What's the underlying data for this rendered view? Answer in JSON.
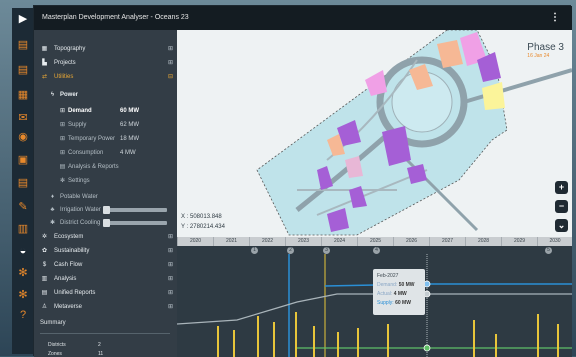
{
  "window": {
    "title": "Masterplan Development Analyser - Oceans 23",
    "menu_icon": "kebab-menu-icon"
  },
  "rail": {
    "icons": [
      "document-icon",
      "document-icon",
      "map-icon",
      "mail-icon",
      "layers-icon",
      "gauge-icon",
      "camera-icon",
      "gear-icon",
      "document-icon",
      "wrench-icon",
      "chart-icon",
      "dashboard-icon",
      "gear-icon",
      "gear-icon",
      "help-icon"
    ]
  },
  "sidebar": {
    "items": [
      {
        "label": "Topography",
        "icon": "map-icon"
      },
      {
        "label": "Projects",
        "icon": "buildings-icon"
      },
      {
        "label": "Utilities",
        "icon": "utilities-icon"
      }
    ],
    "power": {
      "label": "Power",
      "rows": [
        {
          "label": "Demand",
          "value": "60 MW"
        },
        {
          "label": "Supply",
          "value": "62 MW"
        },
        {
          "label": "Temporary Power",
          "value": "18 MW"
        },
        {
          "label": "Consumption",
          "value": "4 MW"
        },
        {
          "label": "Analysis & Reports",
          "value": ""
        },
        {
          "label": "Settings",
          "value": ""
        }
      ]
    },
    "water": [
      {
        "label": "Potable Water"
      },
      {
        "label": "Irrigation Water"
      },
      {
        "label": "District Cooling"
      }
    ],
    "items2": [
      {
        "label": "Ecosystem",
        "icon": "ecosystem-icon"
      },
      {
        "label": "Sustainability",
        "icon": "sustainability-icon"
      },
      {
        "label": "Cash Flow",
        "icon": "dollar-icon"
      },
      {
        "label": "Analysis",
        "icon": "chart-icon"
      },
      {
        "label": "Unified Reports",
        "icon": "report-icon"
      },
      {
        "label": "Metaverse",
        "icon": "person-icon"
      }
    ],
    "summary": {
      "title": "Summary",
      "rows": [
        {
          "label": "Districts",
          "value": "2"
        },
        {
          "label": "Zones",
          "value": "11"
        }
      ]
    }
  },
  "map": {
    "phase_title": "Phase 3",
    "phase_date": "16 Jan 24",
    "x_coord": "X : 508013.848",
    "y_coord": "Y : 2780214.434",
    "zoom_in": "+",
    "zoom_out": "−",
    "collapse": "⌄"
  },
  "timeline": {
    "years": [
      "2020",
      "2021",
      "2022",
      "2023",
      "2024",
      "2025",
      "2026",
      "2027",
      "2028",
      "2029",
      "2030"
    ],
    "markers": [
      "1",
      "2",
      "3",
      "4",
      "5"
    ],
    "tooltip": {
      "date": "Feb-2027",
      "demand_label": "Demand:",
      "demand_value": "50 MW",
      "actual_label": "Actual:",
      "actual_value": "4 MW",
      "supply_label": "Supply:",
      "supply_value": "60 MW"
    },
    "colors": {
      "supply": "#2a8fd6",
      "demand": "#a9b4ba",
      "actual": "#5fbf67",
      "bars": "#e8c53a"
    }
  }
}
